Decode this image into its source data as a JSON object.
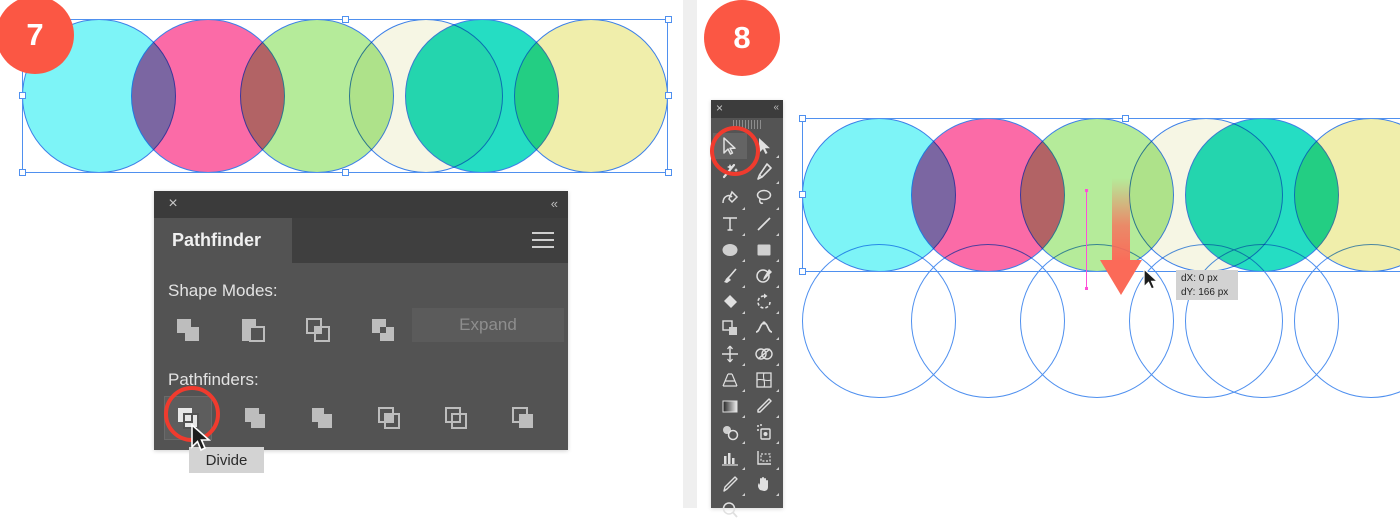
{
  "steps": [
    {
      "number": "7"
    },
    {
      "number": "8"
    }
  ],
  "pathfinder_panel": {
    "title": "Pathfinder",
    "close_icon": "×",
    "collapse_icon": "«",
    "menu_icon": "hamburger-menu-icon",
    "shape_modes_label": "Shape Modes:",
    "pathfinders_label": "Pathfinders:",
    "expand_label": "Expand",
    "shape_mode_buttons": [
      {
        "name": "unite",
        "label": "Unite"
      },
      {
        "name": "minus-front",
        "label": "Minus Front"
      },
      {
        "name": "intersect",
        "label": "Intersect"
      },
      {
        "name": "exclude",
        "label": "Exclude"
      }
    ],
    "pathfinder_buttons": [
      {
        "name": "divide",
        "label": "Divide",
        "selected": true
      },
      {
        "name": "trim",
        "label": "Trim",
        "selected": false
      },
      {
        "name": "merge",
        "label": "Merge",
        "selected": false
      },
      {
        "name": "crop",
        "label": "Crop",
        "selected": false
      },
      {
        "name": "outline",
        "label": "Outline",
        "selected": false
      },
      {
        "name": "minus-back",
        "label": "Minus Back",
        "selected": false
      }
    ],
    "tooltip": "Divide"
  },
  "tools_panel": {
    "close_icon": "×",
    "collapse_icon": "«",
    "tools": [
      {
        "name": "selection-tool",
        "label": "Selection Tool",
        "active": true
      },
      {
        "name": "direct-selection-tool",
        "label": "Direct Selection Tool",
        "active": false
      },
      {
        "name": "magic-wand-tool",
        "label": "Magic Wand Tool",
        "active": false
      },
      {
        "name": "pen-tool",
        "label": "Pen Tool",
        "active": false
      },
      {
        "name": "curvature-tool",
        "label": "Curvature Tool",
        "active": false
      },
      {
        "name": "lasso-tool",
        "label": "Lasso Tool",
        "active": false
      },
      {
        "name": "type-tool",
        "label": "Type Tool",
        "active": false
      },
      {
        "name": "line-segment-tool",
        "label": "Line Segment Tool",
        "active": false
      },
      {
        "name": "ellipse-tool",
        "label": "Ellipse Tool",
        "active": false
      },
      {
        "name": "rectangle-tool",
        "label": "Rectangle Tool",
        "active": false
      },
      {
        "name": "paintbrush-tool",
        "label": "Paintbrush Tool",
        "active": false
      },
      {
        "name": "shaper-tool",
        "label": "Shaper Tool",
        "active": false
      },
      {
        "name": "eraser-tool",
        "label": "Eraser Tool",
        "active": false
      },
      {
        "name": "rotate-tool",
        "label": "Rotate Tool",
        "active": false
      },
      {
        "name": "scale-tool",
        "label": "Scale Tool",
        "active": false
      },
      {
        "name": "width-tool",
        "label": "Width Tool",
        "active": false
      },
      {
        "name": "free-transform-tool",
        "label": "Free Transform Tool",
        "active": false
      },
      {
        "name": "shape-builder-tool",
        "label": "Shape Builder Tool",
        "active": false
      },
      {
        "name": "perspective-grid-tool",
        "label": "Perspective Grid Tool",
        "active": false
      },
      {
        "name": "mesh-tool",
        "label": "Mesh Tool",
        "active": false
      },
      {
        "name": "gradient-tool",
        "label": "Gradient Tool",
        "active": false
      },
      {
        "name": "eyedropper-tool",
        "label": "Eyedropper Tool",
        "active": false
      },
      {
        "name": "blend-tool",
        "label": "Blend Tool",
        "active": false
      },
      {
        "name": "symbol-sprayer-tool",
        "label": "Symbol Sprayer Tool",
        "active": false
      },
      {
        "name": "column-graph-tool",
        "label": "Column Graph Tool",
        "active": false
      },
      {
        "name": "artboard-tool",
        "label": "Artboard Tool",
        "active": false
      },
      {
        "name": "slice-tool",
        "label": "Slice Tool",
        "active": false
      },
      {
        "name": "hand-tool",
        "label": "Hand Tool",
        "active": false
      },
      {
        "name": "zoom-tool",
        "label": "Zoom Tool",
        "active": false
      }
    ]
  },
  "drag_tooltip": {
    "dx": "dX: 0 px",
    "dy": "dY: 166 px"
  },
  "artwork": {
    "colors": {
      "cyan": "#7df4f7",
      "pink": "#fb6ba7",
      "green": "#b5eb9a",
      "cream": "#f6f6e4",
      "teal": "#25ddc3",
      "yellow": "#f0eeab",
      "stroke": "#4f90ef",
      "selection": "#4f90ef",
      "badge": "#fb5744",
      "highlight_ring": "#f03b2e",
      "drag_arrow": "#fb6a58",
      "path_magenta": "#ff4fd8"
    },
    "panel7_circles": [
      {
        "fill": "#7df4f7",
        "name": "circle-cyan-1"
      },
      {
        "fill": "#fb6ba7",
        "name": "circle-pink"
      },
      {
        "fill": "#b5eb9a",
        "name": "circle-green"
      },
      {
        "fill": "#f6f6e4",
        "name": "circle-cream"
      },
      {
        "fill": "#25ddc3",
        "name": "circle-teal"
      },
      {
        "fill": "#f0eeab",
        "name": "circle-yellow"
      }
    ],
    "panel8_circles": [
      {
        "fill": "#7df4f7",
        "name": "circle-cyan-1"
      },
      {
        "fill": "#fb6ba7",
        "name": "circle-pink"
      },
      {
        "fill": "#b5eb9a",
        "name": "circle-green"
      },
      {
        "fill": "#f6f6e4",
        "name": "circle-cream"
      },
      {
        "fill": "#25ddc3",
        "name": "circle-teal"
      },
      {
        "fill": "#f0eeab",
        "name": "circle-yellow"
      }
    ]
  }
}
